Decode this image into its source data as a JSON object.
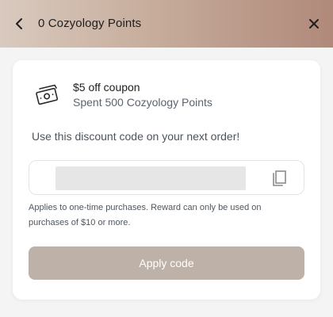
{
  "header": {
    "title": "0 Cozyology Points"
  },
  "icons": {
    "back": "chevron-left-icon",
    "close": "close-icon",
    "coupon": "cash-bill-icon",
    "copy": "copy-icon"
  },
  "reward": {
    "title": "$5 off coupon",
    "subtitle": "Spent 500 Cozyology Points",
    "instruction": "Use this discount code on your next order!",
    "fineprint": "Applies to one-time purchases. Reward can only be used on purchases of $10 or more.",
    "apply_label": "Apply code"
  },
  "colors": {
    "header_gradient_start": "#d9cabf",
    "header_gradient_end": "#b0897a",
    "button_bg": "#beb1a7",
    "subtitle_text": "#5b6470"
  }
}
